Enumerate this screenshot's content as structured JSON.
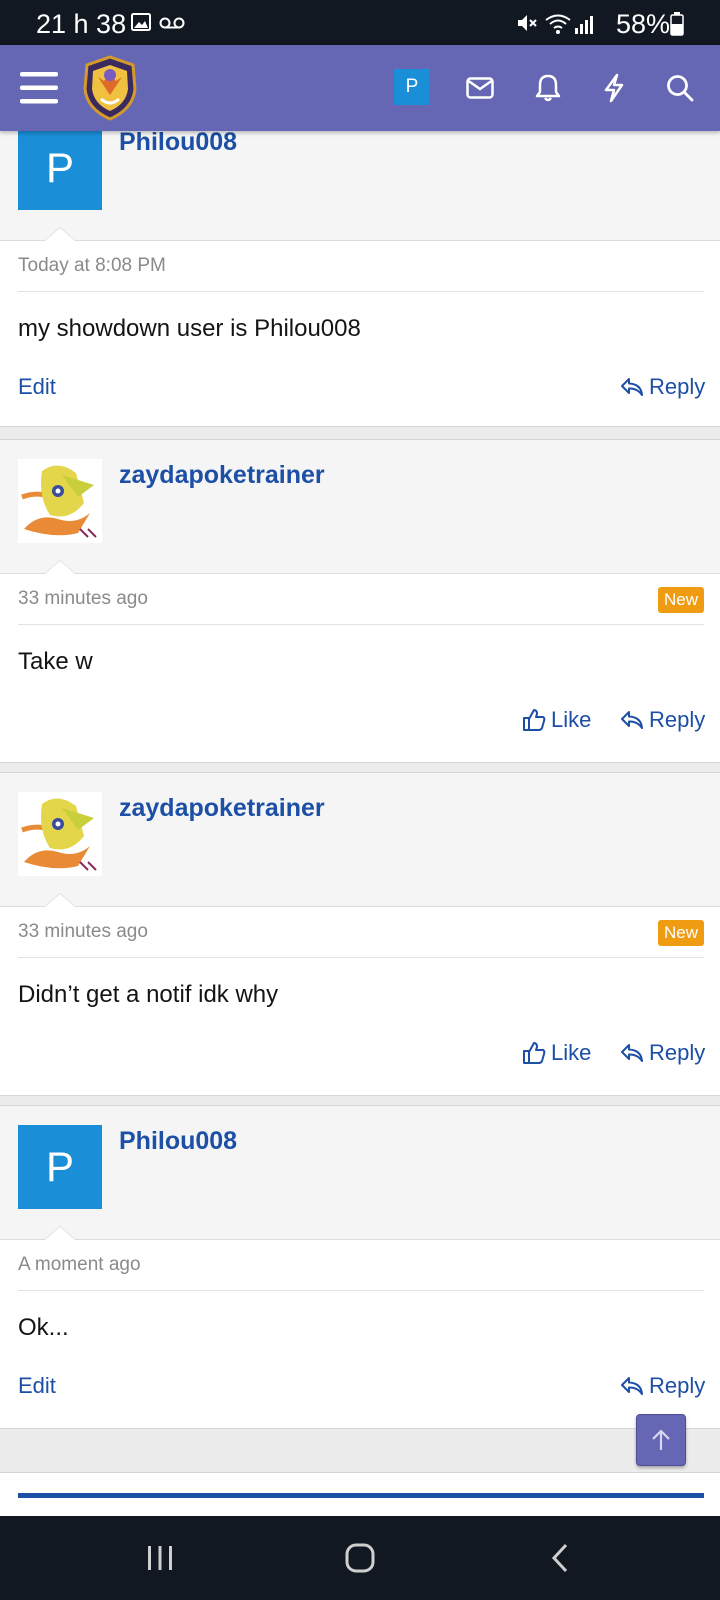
{
  "status_bar": {
    "time": "21 h 38",
    "battery": "58%",
    "icons": [
      "image-icon",
      "voicemail-icon",
      "mute-icon",
      "wifi-icon",
      "signal-icon",
      "battery-icon"
    ]
  },
  "header": {
    "menu_icon": "hamburger-icon",
    "logo": "forum-logo",
    "account_initial": "P",
    "icons": [
      "envelope-icon",
      "bell-icon",
      "lightning-icon",
      "search-icon"
    ],
    "color": "#6566b4"
  },
  "posts": [
    {
      "author": "Philou008",
      "avatar_initial": "P",
      "avatar_type": "letter",
      "date": "Today at 8:08 PM",
      "badge": "",
      "body": "my showdown user is Philou008",
      "actions": {
        "edit": "Edit",
        "like": "",
        "reply": "Reply"
      }
    },
    {
      "author": "zaydapoketrainer",
      "avatar_type": "image",
      "date": "33 minutes ago",
      "badge": "New",
      "body": "Take w",
      "actions": {
        "edit": "",
        "like": "Like",
        "reply": "Reply"
      }
    },
    {
      "author": "zaydapoketrainer",
      "avatar_type": "image",
      "date": "33 minutes ago",
      "badge": "New",
      "body": "Didn’t get a notif idk why",
      "actions": {
        "edit": "",
        "like": "Like",
        "reply": "Reply"
      }
    },
    {
      "author": "Philou008",
      "avatar_initial": "P",
      "avatar_type": "letter",
      "date": "A moment ago",
      "badge": "",
      "body": "Ok...",
      "actions": {
        "edit": "Edit",
        "like": "",
        "reply": "Reply"
      }
    }
  ],
  "scroll_top_icon": "arrow-up-icon",
  "nav_bar": {
    "icons": [
      "recents-icon",
      "home-icon",
      "back-icon"
    ]
  },
  "colors": {
    "link": "#1c4fa5",
    "badge_new": "#f09c13",
    "avatar_blue": "#1a8ed6"
  }
}
